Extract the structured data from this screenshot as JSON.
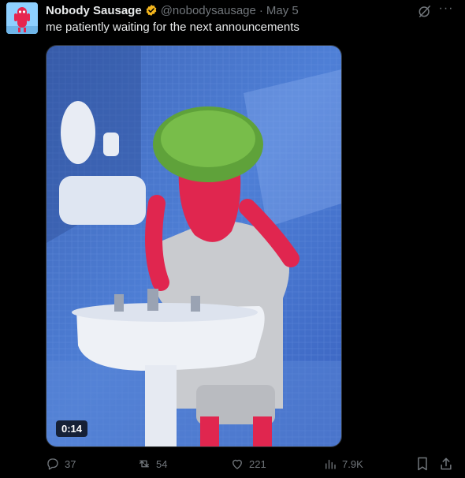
{
  "tweet": {
    "author_name": "Nobody Sausage",
    "handle": "@nobodysausage",
    "separator": "·",
    "date": "May 5",
    "text": "me patiently waiting for the next announcements",
    "video_duration": "0:14"
  },
  "actions": {
    "replies": "37",
    "reposts": "54",
    "likes": "221",
    "views": "7.9K"
  },
  "more_label": "···",
  "colors": {
    "background": "#000000",
    "text": "#e7e9ea",
    "muted": "#71767b",
    "verified": "#f3b51d"
  }
}
